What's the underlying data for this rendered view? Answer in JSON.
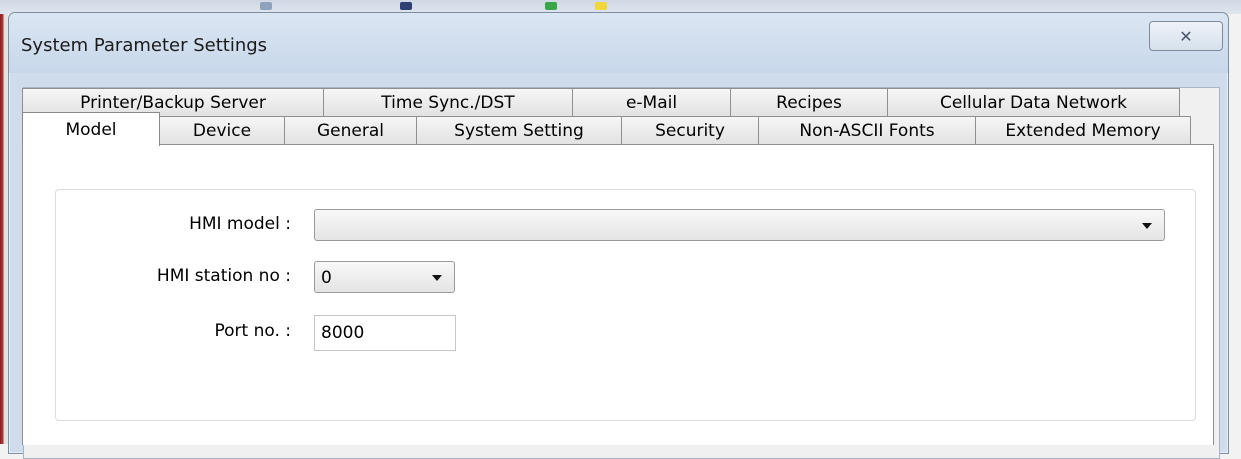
{
  "window": {
    "title": "System Parameter Settings",
    "close_label": "✕"
  },
  "tabs": {
    "back_row": [
      {
        "label": "Printer/Backup Server"
      },
      {
        "label": "Time Sync./DST"
      },
      {
        "label": "e-Mail"
      },
      {
        "label": "Recipes"
      },
      {
        "label": "Cellular Data Network"
      }
    ],
    "front_row": [
      {
        "label": "Model",
        "active": true
      },
      {
        "label": "Device"
      },
      {
        "label": "General"
      },
      {
        "label": "System Setting"
      },
      {
        "label": "Security"
      },
      {
        "label": "Non-ASCII Fonts"
      },
      {
        "label": "Extended Memory"
      }
    ]
  },
  "form": {
    "hmi_model": {
      "label": "HMI model :",
      "value": ""
    },
    "hmi_station": {
      "label": "HMI station no :",
      "value": "0"
    },
    "port": {
      "label": "Port no. :",
      "value": "8000"
    }
  }
}
